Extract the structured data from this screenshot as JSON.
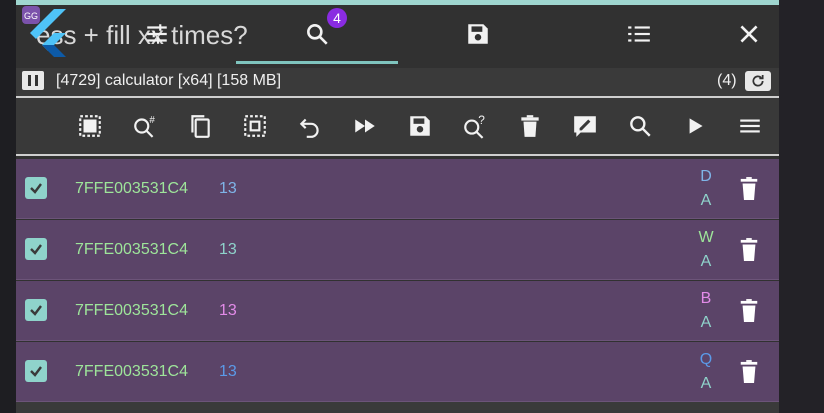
{
  "app": {
    "title_behind": "ess + fill xx times?",
    "search_badge": "4",
    "tabs": [
      "settings-icon",
      "search-icon",
      "save-icon",
      "list-icon",
      "close-icon"
    ]
  },
  "process": {
    "text": "[4729] calculator [x64] [158 MB]",
    "count": "(4)"
  },
  "toolbar": {
    "icons": [
      "select-all-icon",
      "search-hex-icon",
      "copy-icon",
      "select-range-icon",
      "undo-icon",
      "fast-forward-icon",
      "save-icon",
      "search-unknown-icon",
      "delete-icon",
      "edit-icon",
      "search-icon",
      "play-icon",
      "menu-icon"
    ]
  },
  "results": [
    {
      "address": "7FFE003531C4",
      "value": "13",
      "type": "D",
      "subtype": "A",
      "checked": true,
      "value_color": "#7fb4e8",
      "type_color": "#7fb4e8"
    },
    {
      "address": "7FFE003531C4",
      "value": "13",
      "type": "W",
      "subtype": "A",
      "checked": true,
      "value_color": "#8fd3cb",
      "type_color": "#9ee59a"
    },
    {
      "address": "7FFE003531C4",
      "value": "13",
      "type": "B",
      "subtype": "A",
      "checked": true,
      "value_color": "#e28be8",
      "type_color": "#e28be8"
    },
    {
      "address": "7FFE003531C4",
      "value": "13",
      "type": "Q",
      "subtype": "A",
      "checked": true,
      "value_color": "#5b9ae8",
      "type_color": "#5b9ae8"
    }
  ]
}
